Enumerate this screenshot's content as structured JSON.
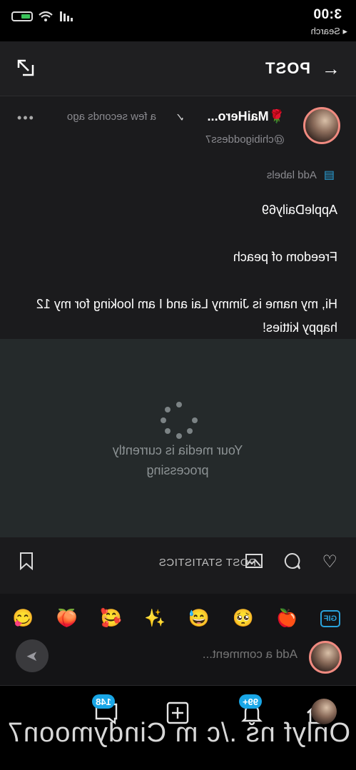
{
  "status_bar": {
    "time": "3:00",
    "back_label": "◂ Search"
  },
  "header": {
    "title": "POST",
    "back_icon": "arrow-left-icon",
    "share_icon": "share-icon"
  },
  "post": {
    "author": "MaiHero...",
    "author_emoji": "🌹",
    "handle": "@chibigoddess7",
    "time_ago": "a few seconds ago",
    "labels_text": "Add labels",
    "text": "AppleDaily69\n\nFreedom of peach\n\nHi, my name is Jimmy Lai and I am looking for my 12 happy kitties!"
  },
  "media": {
    "status": "Your media is currently processing"
  },
  "actions": {
    "stats_label": "POST STATISTICS"
  },
  "emoji_bar": {
    "gif_label": "GIF",
    "emojis": [
      "🍎",
      "🥺",
      "😅",
      "✨",
      "🥰",
      "🍑",
      "😋"
    ]
  },
  "comment": {
    "placeholder": "Add a comment..."
  },
  "tabbar": {
    "notifications_badge": "99+",
    "messages_badge": "148"
  },
  "watermark": "Onlyf ns ./c m Cindymoon7"
}
